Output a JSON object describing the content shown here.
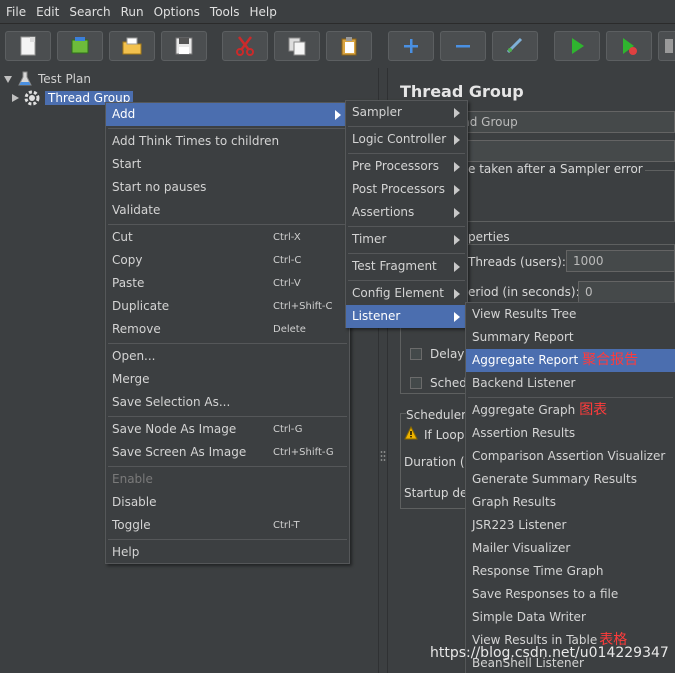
{
  "menubar": {
    "items": [
      "File",
      "Edit",
      "Search",
      "Run",
      "Options",
      "Tools",
      "Help"
    ]
  },
  "toolbar": {
    "icons": [
      "new-icon",
      "templates-icon",
      "open-icon",
      "save-icon",
      "cut-icon",
      "copy-icon",
      "paste-icon",
      "expand-icon",
      "collapse-icon",
      "toggle-icon",
      "start-icon",
      "start-no-pauses-icon",
      "stop-icon"
    ]
  },
  "tree": {
    "test_plan": "Test Plan",
    "thread_group": "Thread Group"
  },
  "right_panel": {
    "title": "Thread Group",
    "name_field": "ead Group",
    "error_label": "e taken after a Sampler error",
    "properties_label": "perties",
    "threads_label": "Threads (users):",
    "threads_value": "1000",
    "period_label": "eriod (in seconds):",
    "period_value": "0",
    "delay_label": "Delay",
    "sched_label": "Sched",
    "scheduler_label": "Scheduler",
    "if_loop_label": "If Loop",
    "duration_label": "Duration (s",
    "startup_label": "Startup del"
  },
  "context_menu": {
    "add": "Add",
    "add_think_times": "Add Think Times to children",
    "start": "Start",
    "start_no_pauses": "Start no pauses",
    "validate": "Validate",
    "cut": "Cut",
    "cut_shortcut": "Ctrl-X",
    "copy": "Copy",
    "copy_shortcut": "Ctrl-C",
    "paste": "Paste",
    "paste_shortcut": "Ctrl-V",
    "duplicate": "Duplicate",
    "duplicate_shortcut": "Ctrl+Shift-C",
    "remove": "Remove",
    "remove_shortcut": "Delete",
    "open": "Open...",
    "merge": "Merge",
    "save_selection": "Save Selection As...",
    "save_node_image": "Save Node As Image",
    "save_node_image_shortcut": "Ctrl-G",
    "save_screen_image": "Save Screen As Image",
    "save_screen_image_shortcut": "Ctrl+Shift-G",
    "enable": "Enable",
    "disable": "Disable",
    "toggle": "Toggle",
    "toggle_shortcut": "Ctrl-T",
    "help": "Help"
  },
  "add_menu": {
    "sampler": "Sampler",
    "logic_controller": "Logic Controller",
    "pre_processors": "Pre Processors",
    "post_processors": "Post Processors",
    "assertions": "Assertions",
    "timer": "Timer",
    "test_fragment": "Test Fragment",
    "config_element": "Config Element",
    "listener": "Listener"
  },
  "listener_menu": {
    "view_results_tree": "View Results Tree",
    "summary_report": "Summary Report",
    "aggregate_report": "Aggregate Report",
    "aggregate_report_note": "聚合报告",
    "backend_listener": "Backend Listener",
    "aggregate_graph": "Aggregate Graph",
    "aggregate_graph_note": "图表",
    "assertion_results": "Assertion Results",
    "comparison_assertion_visualizer": "Comparison Assertion Visualizer",
    "generate_summary_results": "Generate Summary Results",
    "graph_results": "Graph Results",
    "jsr223_listener": "JSR223 Listener",
    "mailer_visualizer": "Mailer Visualizer",
    "response_time_graph": "Response Time Graph",
    "save_responses": "Save Responses to a file",
    "simple_data_writer": "Simple Data Writer",
    "view_results_table": "View Results in Table",
    "view_results_table_note": "表格",
    "beanshell_listener": "BeanShell Listener"
  },
  "watermark": "https://blog.csdn.net/u014229347",
  "colors": {
    "background": "#3c3f41",
    "selection": "#4b6eaf",
    "annotation": "#ff3b3b"
  }
}
